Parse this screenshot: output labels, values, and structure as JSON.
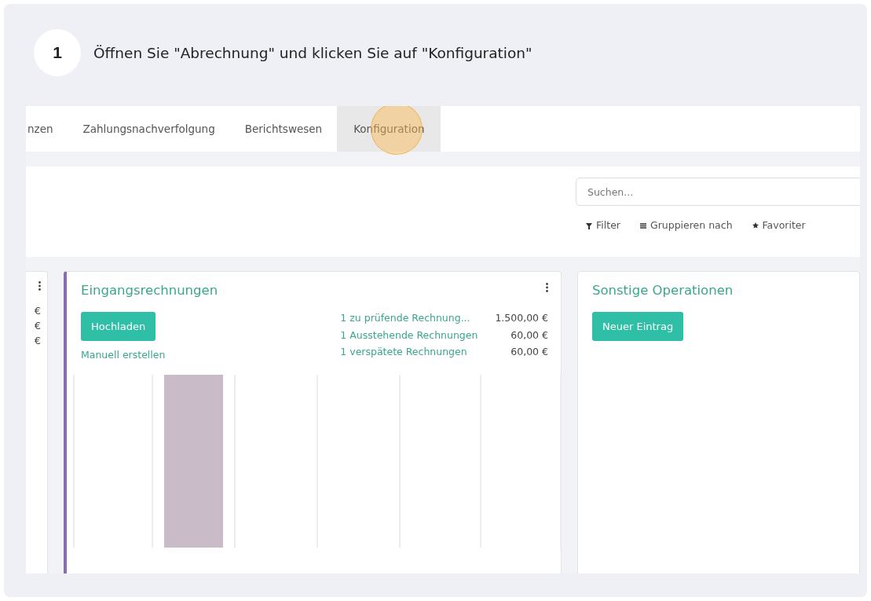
{
  "step": {
    "number": "1",
    "instruction": "Öffnen Sie \"Abrechnung\" und klicken Sie auf \"Konfiguration\""
  },
  "nav": {
    "tabs": [
      {
        "label": "nzen",
        "selected": false,
        "clicked": false
      },
      {
        "label": "Zahlungsnachverfolgung",
        "selected": false,
        "clicked": false
      },
      {
        "label": "Berichtswesen",
        "selected": false,
        "clicked": false
      },
      {
        "label": "Konfiguration",
        "selected": true,
        "clicked": true
      }
    ]
  },
  "control_panel": {
    "search": {
      "placeholder": "Suchen..."
    },
    "filters": [
      {
        "kind": "filter",
        "label": "Filter"
      },
      {
        "kind": "group",
        "label": "Gruppieren nach"
      },
      {
        "kind": "favorites",
        "label": "Favoriter"
      }
    ]
  },
  "cards": [
    {
      "kind": "partial",
      "amounts": [
        "€",
        "€",
        "€"
      ]
    },
    {
      "kind": "journal",
      "title": "Eingangsrechnungen",
      "color": "#8b6bb1",
      "buttons": [
        "Hochladen"
      ],
      "links": [
        "Manuell erstellen"
      ],
      "graph": true,
      "stats": [
        {
          "label": "1 zu prüfende Rechnung...",
          "amount": "1.500,00 €"
        },
        {
          "label": "1 Ausstehende Rechnungen",
          "amount": "60,00 €"
        },
        {
          "label": "1 verspätete Rechnungen",
          "amount": "60,00 €"
        }
      ]
    },
    {
      "kind": "journal",
      "title": "Sonstige Operationen",
      "buttons": [
        "Neuer Eintrag"
      ]
    }
  ]
}
